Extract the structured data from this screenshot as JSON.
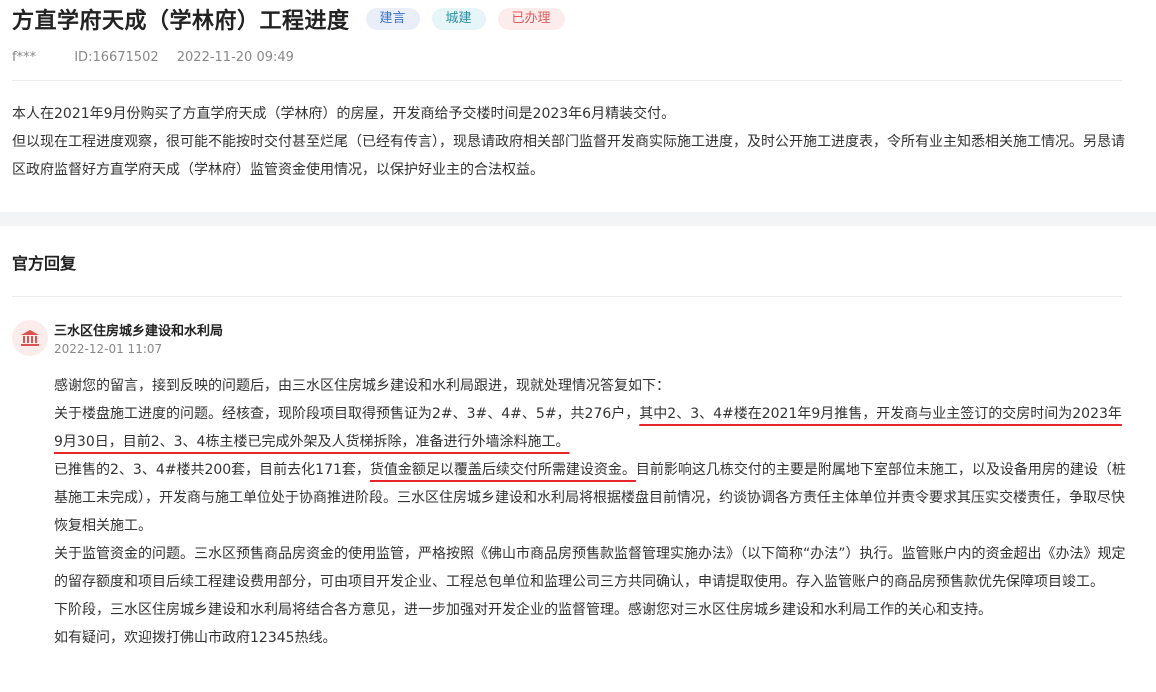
{
  "header": {
    "title": "方直学府天成（学林府）工程进度",
    "tags": [
      {
        "label": "建言",
        "bg": "#e9eef8",
        "color": "#3c73c8"
      },
      {
        "label": "城建",
        "bg": "#e6f5f7",
        "color": "#2a8fa3"
      },
      {
        "label": "已办理",
        "bg": "#fdecec",
        "color": "#e05b5b"
      }
    ],
    "user": "f***",
    "id": "ID:16671502",
    "time": "2022-11-20 09:49"
  },
  "message": {
    "p1": "本人在2021年9月份购买了方直学府天成（学林府）的房屋，开发商给予交楼时间是2023年6月精装交付。",
    "p2": "但以现在工程进度观察，很可能不能按时交付甚至烂尾（已经有传言），现恳请政府相关部门监督开发商实际施工进度，及时公开施工进度表，令所有业主知悉相关施工情况。另恳请区政府监督好方直学府天成（学林府）监管资金使用情况，以保护好业主的合法权益。"
  },
  "reply": {
    "section_title": "官方回复",
    "avatar_icon": "government-building-icon",
    "department": "三水区住房城乡建设和水利局",
    "time": "2022-12-01 11:07",
    "p1": "感谢您的留言，接到反映的问题后，由三水区住房城乡建设和水利局跟进，现就处理情况答复如下：",
    "p2a": "关于楼盘施工进度的问题。经核查，现阶段项目取得预售证为2#、3#、4#、5#，共276户，",
    "p2b": "其中2、3、4#楼在2021年9月推售，开发商与业主签订的交房时间为2023年9月30日，目前2、3、4栋主楼已完成外架及人货梯拆除，准备进行外墙涂料施工。",
    "p3a": "已推售的2、3、4#楼共200套，目前去化171套，",
    "p3b": "货值金额足以覆盖后续交付所需建设资金。",
    "p3c": "目前影响这几栋交付的主要是附属地下室部位未施工，以及设备用房的建设（桩基施工未完成），开发商与施工单位处于协商推进阶段。三水区住房城乡建设和水利局将根据楼盘目前情况，约谈协调各方责任主体单位并责令要求其压实交楼责任，争取尽快恢复相关施工。",
    "p4": "关于监管资金的问题。三水区预售商品房资金的使用监管，严格按照《佛山市商品房预售款监督管理实施办法》（以下简称“办法”）执行。监管账户内的资金超出《办法》规定的留存额度和项目后续工程建设费用部分，可由项目开发企业、工程总包单位和监理公司三方共同确认，申请提取使用。存入监管账户的商品房预售款优先保障项目竣工。",
    "p5": "下阶段，三水区住房城乡建设和水利局将结合各方意见，进一步加强对开发企业的监督管理。感谢您对三水区住房城乡建设和水利局工作的关心和支持。",
    "p6": "如有疑问，欢迎拨打佛山市政府12345热线。"
  }
}
